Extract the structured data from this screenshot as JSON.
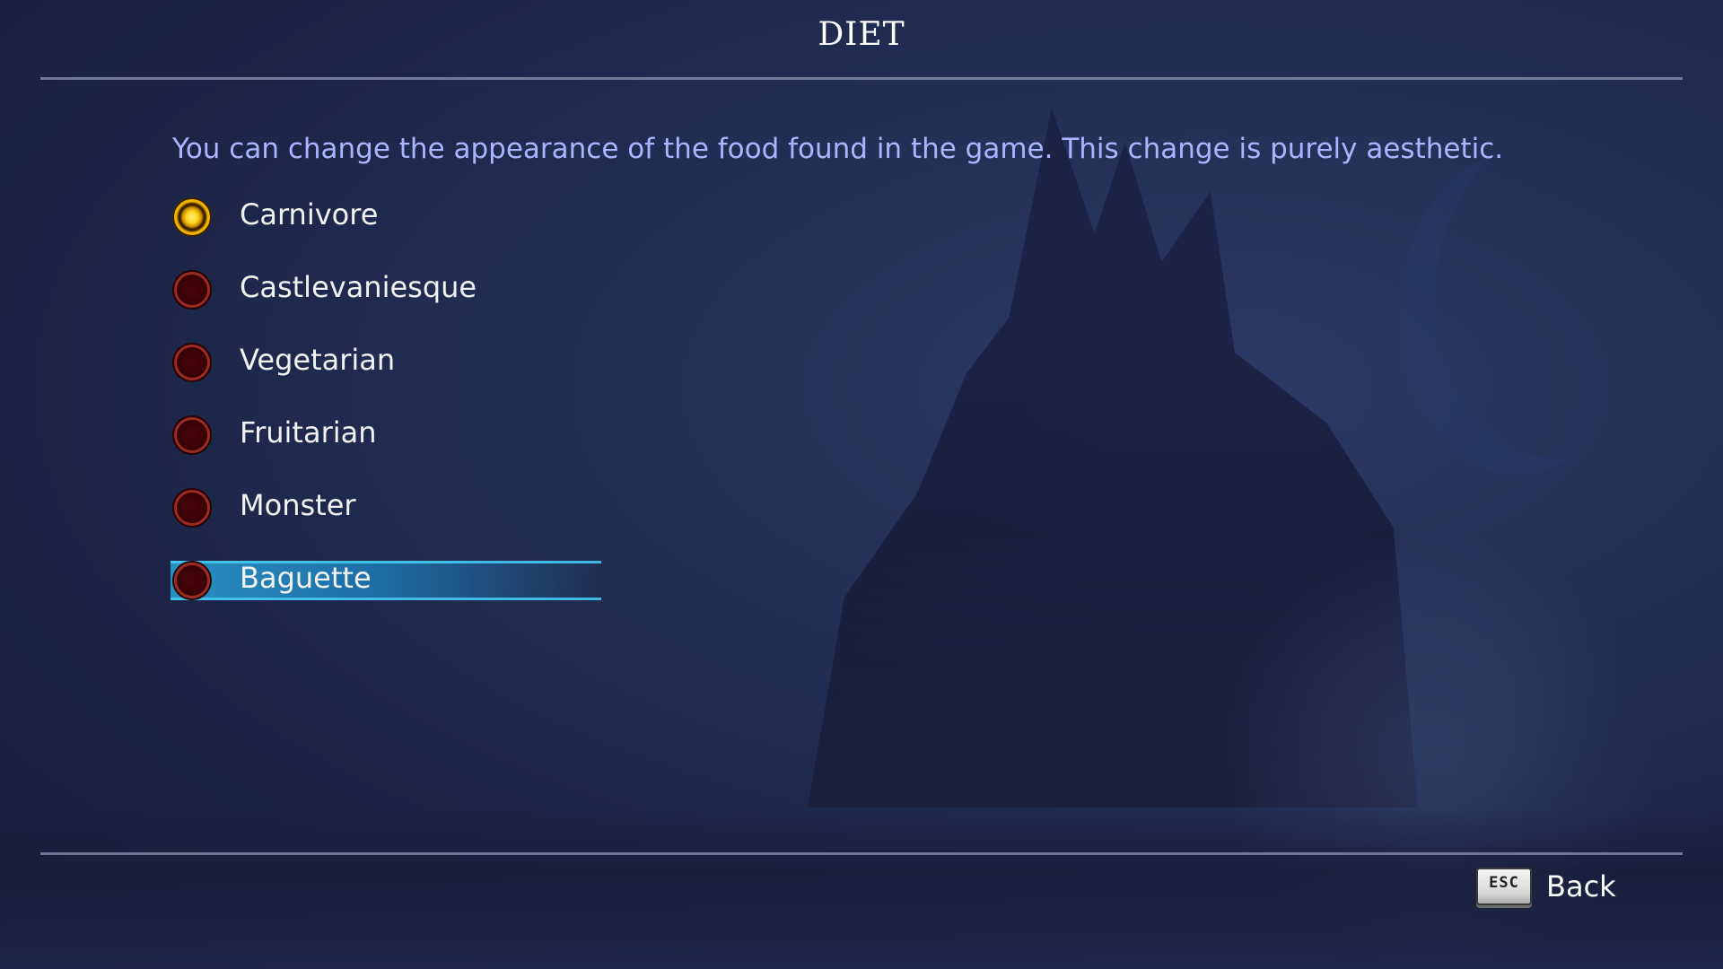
{
  "screen": {
    "title": "DIET",
    "description": "You can change the appearance of the food found in the game. This change is purely aesthetic."
  },
  "diet_options": {
    "selected": "Carnivore",
    "focused": "Baguette",
    "items": [
      {
        "label": "Carnivore",
        "selected": true
      },
      {
        "label": "Castlevaniesque",
        "selected": false
      },
      {
        "label": "Vegetarian",
        "selected": false
      },
      {
        "label": "Fruitarian",
        "selected": false
      },
      {
        "label": "Monster",
        "selected": false
      },
      {
        "label": "Baguette",
        "selected": false
      }
    ]
  },
  "footer": {
    "key_label": "ESC",
    "back_label": "Back"
  },
  "colors": {
    "description_text": "#a9b6ff",
    "radio_selected": "#ffd21c",
    "radio_unselected": "#4a0508",
    "highlight": "#2896c8"
  }
}
